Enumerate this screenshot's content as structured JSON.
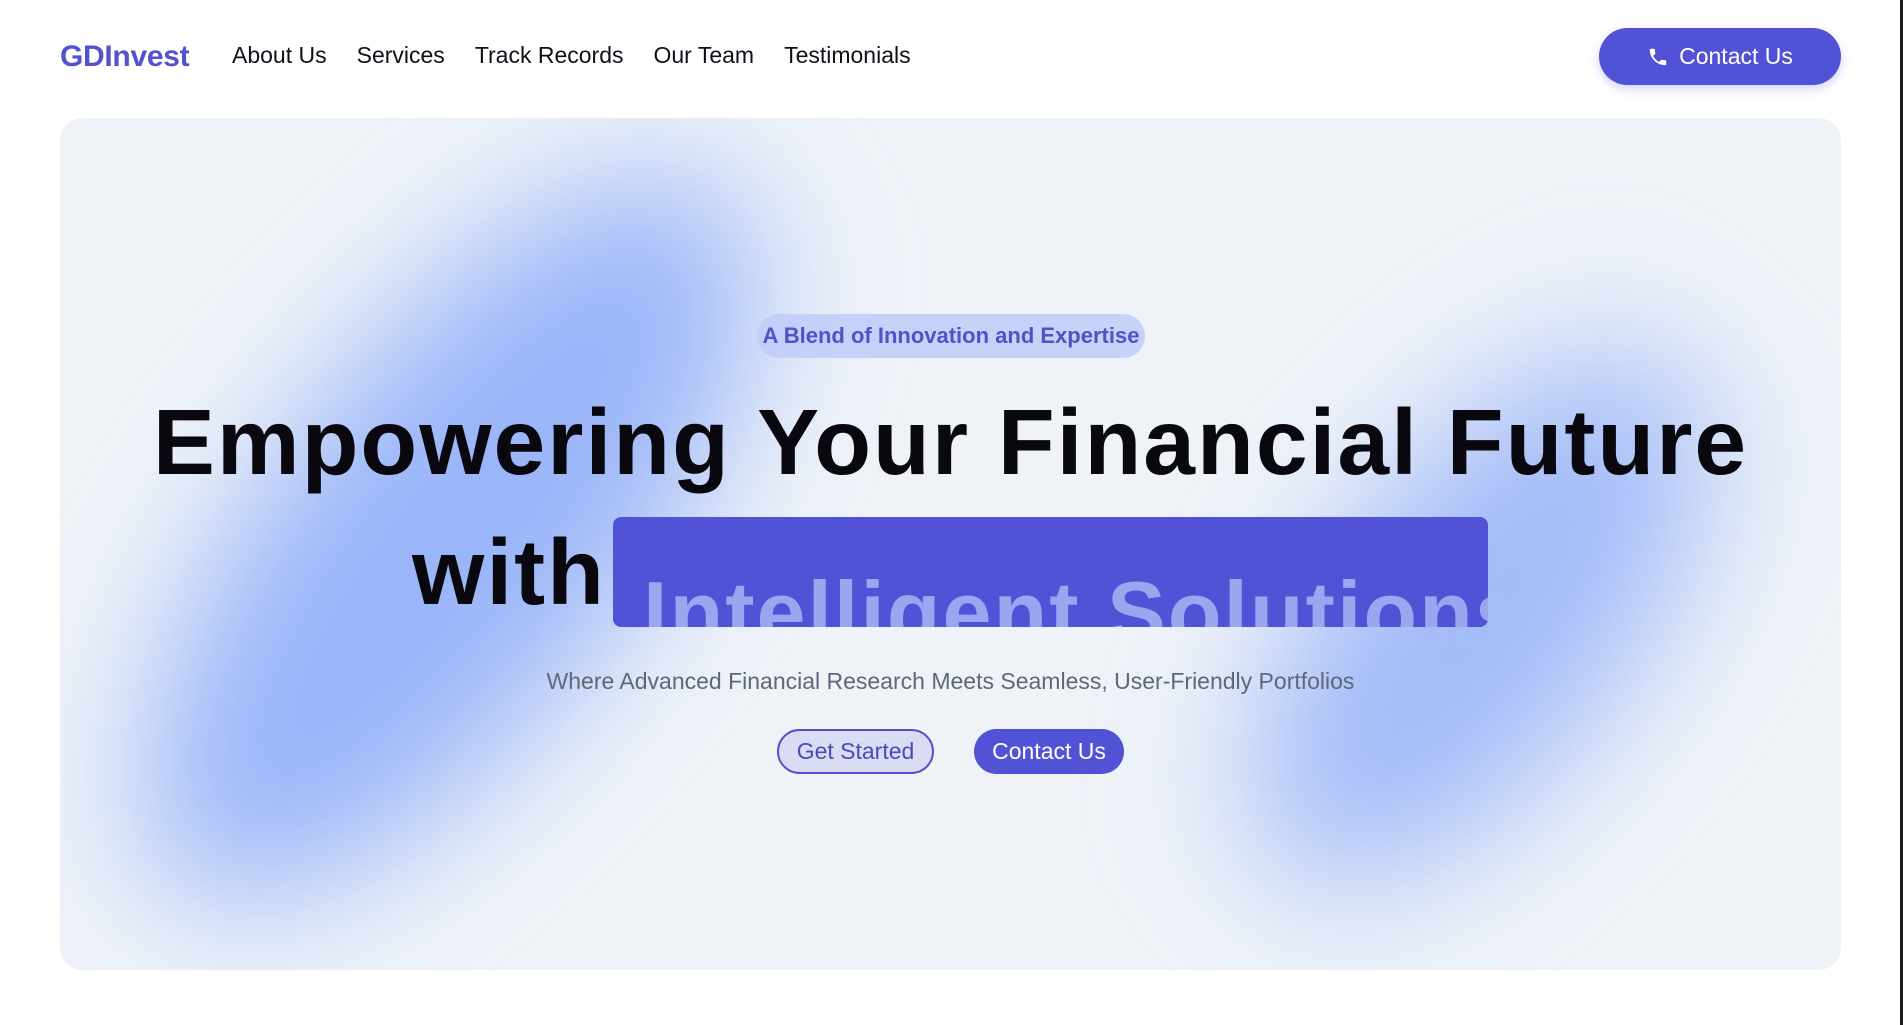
{
  "header": {
    "logo": "GDInvest",
    "nav": [
      "About Us",
      "Services",
      "Track Records",
      "Our Team",
      "Testimonials"
    ],
    "contact_label": "Contact Us",
    "contact_icon": "phone-icon"
  },
  "hero": {
    "badge": "A Blend of Innovation and Expertise",
    "headline_line1": "Empowering Your Financial Future",
    "headline_line2_prefix": "with",
    "headline_highlight": "Intelligent Solutions",
    "subtitle": "Where Advanced Financial Research Meets Seamless, User-Friendly Portfolios",
    "get_started_label": "Get Started",
    "contact_label": "Contact Us"
  },
  "colors": {
    "brand": "#5252d6",
    "hero_background": "#eff3f8",
    "badge_background": "#bfcbf8",
    "subtitle_text": "#5e6878"
  }
}
